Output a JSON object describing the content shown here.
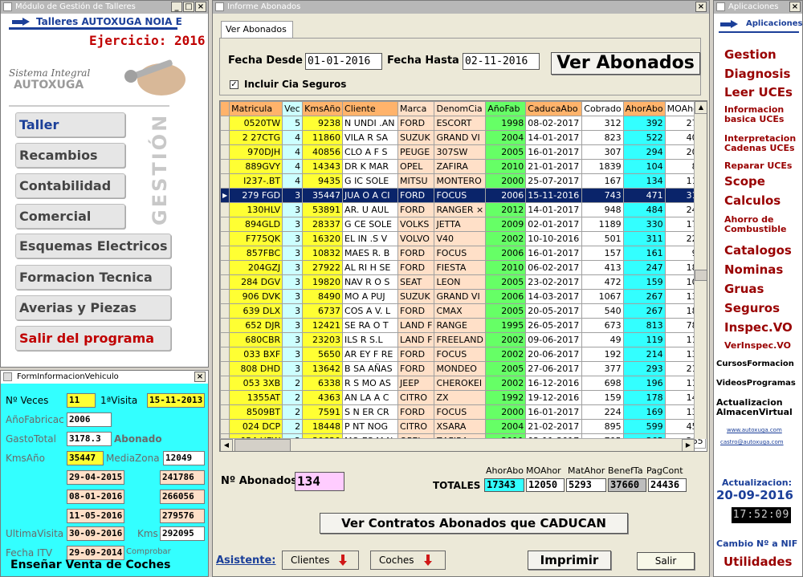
{
  "left_window": {
    "title": "Módulo de Gestión de Talleres",
    "workshop": "Talleres AUTOXUGA NOIA E",
    "ejercicio": "Ejercicio: 2016",
    "sistema1": "Sistema Integral",
    "sistema2": "AUTOXUGA",
    "vertical_label": "GESTIÓN",
    "menu": [
      "Taller",
      "Recambios",
      "Contabilidad",
      "Comercial",
      "Esquemas Electricos",
      "Formacion Tecnica",
      "Averias y Piezas",
      "Salir del programa"
    ]
  },
  "vehicle_form": {
    "title": "FormInformacionVehiculo",
    "nveces_label": "Nº Veces",
    "nveces": "11",
    "primera_label": "1ªVisita",
    "primera": "15-11-2013",
    "afab_label": "AñoFabricac",
    "afab": "2006",
    "gasto_label": "GastoTotal",
    "gasto": "3178.3",
    "abonado_label": "Abonado",
    "kms_label": "KmsAño",
    "kms": "35447",
    "media_label": "MediaZona",
    "media": "12049",
    "rows": [
      {
        "date": "29-04-2015",
        "km": "241786"
      },
      {
        "date": "08-01-2016",
        "km": "266056"
      },
      {
        "date": "11-05-2016",
        "km": "279576"
      }
    ],
    "ultima_label": "UltimaVisita",
    "ultima": "30-09-2016",
    "kms2_label": "Kms",
    "kms2": "292095",
    "itv_label": "Fecha ITV",
    "itv": "29-09-2014",
    "comprobar": "Comprobar",
    "ensenar": "Enseñar Venta de Coches"
  },
  "main_window": {
    "title": "Informe Abonados",
    "tab": "Ver Abonados",
    "fecha_desde_label": "Fecha Desde",
    "fecha_desde": "01-01-2016",
    "fecha_hasta_label": "Fecha Hasta",
    "fecha_hasta": "02-11-2016",
    "ver_btn": "Ver Abonados",
    "incluir_label": "Incluir Cia Seguros",
    "columns": [
      "Matricula",
      "Vec",
      "KmsAño",
      "Cliente",
      "Marca",
      "DenomCia",
      "AñoFab",
      "CaducaAbo",
      "Cobrado",
      "AhorAbo",
      "MOAhor"
    ],
    "rows": [
      [
        "0520TW",
        "5",
        "9238",
        "N  UNDI .AN",
        "FORD",
        "ESCORT",
        "1998",
        "08-02-2017",
        "312",
        "392",
        "273"
      ],
      [
        "2 27CTG",
        "4",
        "11860",
        "VILA  R  SA",
        "SUZUK",
        "GRAND VI",
        "2004",
        "14-01-2017",
        "823",
        "522",
        "401"
      ],
      [
        "970DJH",
        "4",
        "40856",
        "CLO  A  F  S",
        "PEUGE",
        "307SW",
        "2005",
        "16-01-2017",
        "307",
        "294",
        "207"
      ],
      [
        "889GVY",
        "4",
        "14343",
        "DR  K   MAR",
        "OPEL",
        "ZAFIRA",
        "2010",
        "21-01-2017",
        "1839",
        "104",
        "83"
      ],
      [
        "I237-.BT",
        "4",
        "9435",
        "G  IC  SOLE",
        "MITSU",
        "MONTERO",
        "2000",
        "25-07-2017",
        "167",
        "134",
        "118"
      ],
      [
        "279 FGD",
        "3",
        "35447",
        "JUA  O  A CI",
        "FORD",
        "FOCUS",
        "2006",
        "15-11-2016",
        "743",
        "471",
        "312"
      ],
      [
        "130HLV",
        "3",
        "53891",
        "AR.   U AUL",
        "FORD",
        "RANGER ×",
        "2012",
        "14-01-2017",
        "948",
        "484",
        "249"
      ],
      [
        "894GLD",
        "3",
        "28337",
        "G   CE SOLE",
        "VOLKS",
        "JETTA",
        "2009",
        "02-01-2017",
        "1189",
        "330",
        "178"
      ],
      [
        "F775QK",
        "3",
        "16320",
        "  EL IN  .S V",
        "VOLVO",
        "V40",
        "2002",
        "10-10-2016",
        "501",
        "311",
        "225"
      ],
      [
        "857FBC",
        "3",
        "10832",
        "MAES  R.  B",
        "FORD",
        "FOCUS",
        "2006",
        "16-01-2017",
        "157",
        "161",
        "99"
      ],
      [
        "204GZJ",
        "3",
        "27922",
        "AL  RI  H SE",
        "FORD",
        "FIESTA",
        "2010",
        "06-02-2017",
        "413",
        "247",
        "188"
      ],
      [
        "284 DGV",
        "3",
        "19820",
        "NAV  R  O  S",
        "SEAT",
        "LEON",
        "2005",
        "23-02-2017",
        "472",
        "159",
        "101"
      ],
      [
        "906 DVK",
        "3",
        "8490",
        "MO  A   PUJ",
        "SUZUK",
        "GRAND VI",
        "2006",
        "14-03-2017",
        "1067",
        "267",
        "138"
      ],
      [
        "639 DLX",
        "3",
        "6737",
        "COS  A  V. L",
        "FORD",
        "CMAX",
        "2005",
        "20-05-2017",
        "540",
        "267",
        "188"
      ],
      [
        "652 DJR",
        "3",
        "12421",
        "SE  RA  O  T",
        "LAND F",
        "RANGE",
        "1995",
        "26-05-2017",
        "673",
        "813",
        "788"
      ],
      [
        "680CBR",
        "3",
        "23203",
        " ILS  R S.L",
        "LAND F",
        "FREELAND",
        "2002",
        "09-06-2017",
        "49",
        "119",
        "117"
      ],
      [
        "033 BXF",
        "3",
        "5650",
        "AR  EY  F  RE",
        "FORD",
        "FOCUS",
        "2002",
        "20-06-2017",
        "192",
        "214",
        "130"
      ],
      [
        "808 DHD",
        "3",
        "13642",
        "B  SA  AÑAS",
        "FORD",
        "MONDEO",
        "2005",
        "27-06-2017",
        "377",
        "293",
        "213"
      ],
      [
        "053 3XB",
        "2",
        "6338",
        "R  S MO  AS",
        "JEEP",
        "CHEROKEI",
        "2002",
        "16-12-2016",
        "698",
        "196",
        "113"
      ],
      [
        "1355AT",
        "2",
        "4363",
        "AN  LA  A  C",
        "CITRO",
        "ZX",
        "1992",
        "19-12-2016",
        "159",
        "178",
        "140"
      ],
      [
        "8509BT",
        "2",
        "7591",
        "S  N ER  CR",
        "FORD",
        "FOCUS",
        "2000",
        "16-01-2017",
        "224",
        "169",
        "136"
      ],
      [
        "024 DCP",
        "2",
        "18448",
        "P  NT   NOG",
        "CITRO",
        "XSARA",
        "2004",
        "21-02-2017",
        "895",
        "599",
        "452"
      ],
      [
        "054 HFW",
        "2",
        "30630",
        "MO  ES M  N",
        "OPEL",
        "ZAFIRA",
        "2011",
        "02-11-2017",
        "705",
        "365",
        "265"
      ]
    ],
    "selected_row": 5,
    "nabonados_label": "Nº Abonados",
    "nabonados": "134",
    "totales_label": "TOTALES",
    "tot_headers": [
      "AhorAbo",
      "MOAhor",
      "MatAhor",
      "BenefTa",
      "PagCont"
    ],
    "tot_values": [
      "17343",
      "12050",
      "5293",
      "37660",
      "24436"
    ],
    "caducan_btn": "Ver Contratos Abonados que CADUCAN",
    "asistente": "Asistente:",
    "clientes_btn": "Clientes",
    "coches_btn": "Coches",
    "imprimir_btn": "Imprimir",
    "salir_btn": "Salir"
  },
  "right_window": {
    "title": "Aplicaciones",
    "header": "Aplicaciones",
    "links": {
      "gestion": "Gestion",
      "diagnosis": "Diagnosis",
      "leer": "Leer UCEs",
      "info1": "Informacion",
      "info2": "basica UCEs",
      "interp1": "Interpretacion",
      "interp2": "Cadenas UCEs",
      "reparar": "Reparar UCEs",
      "scope": "Scope",
      "calculos": "Calculos",
      "ahorro1": "Ahorro de",
      "ahorro2": "Combustible",
      "catalogos": "Catalogos",
      "nominas": "Nominas",
      "gruas": "Gruas",
      "seguros": "Seguros",
      "inspec": "Inspec.VO",
      "verinspec": "VerInspec.VO",
      "cursos": "CursosFormacion",
      "videos": "VideosProgramas",
      "actual1": "Actualizacion",
      "actual2": "AlmacenVirtual",
      "web": "www.autoxuga.com",
      "mail": "castro@autoxuga.com"
    },
    "actualizacion_label": "Actualizacion:",
    "actualizacion": "20-09-2016",
    "clock": "17:52:09",
    "cambio": "Cambio Nº a NIF",
    "utilidades": "Utilidades"
  }
}
